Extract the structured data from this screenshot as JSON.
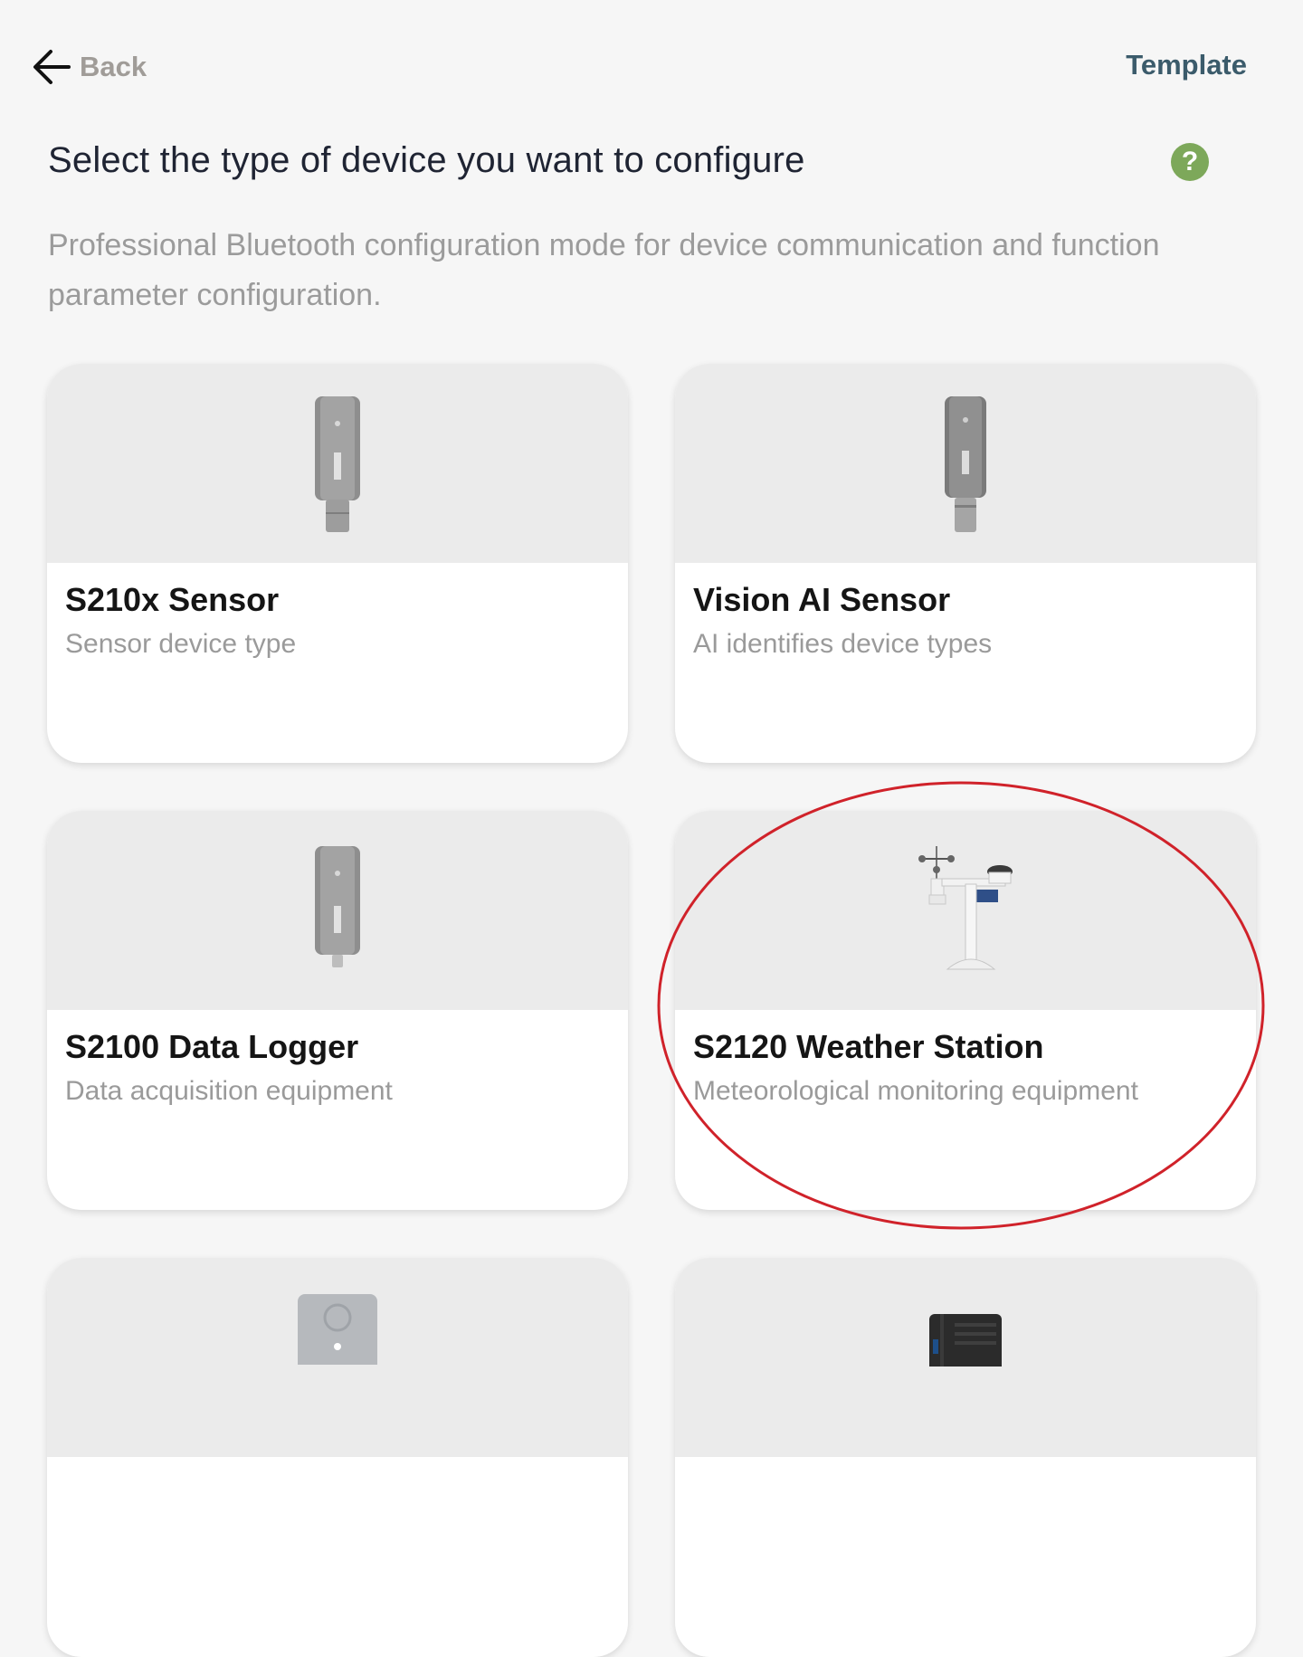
{
  "header": {
    "back_label": "Back",
    "template_label": "Template"
  },
  "page": {
    "title": "Select the type of device you want to configure",
    "help_symbol": "?",
    "subtitle": "Professional Bluetooth configuration mode for device communication and function parameter configuration."
  },
  "devices": [
    {
      "name": "S210x Sensor",
      "description": "Sensor device type",
      "icon": "sensor-device-icon"
    },
    {
      "name": "Vision AI Sensor",
      "description": "AI identifies device types",
      "icon": "vision-sensor-icon"
    },
    {
      "name": "S2100 Data Logger",
      "description": "Data acquisition equipment",
      "icon": "data-logger-icon"
    },
    {
      "name": "S2120 Weather Station",
      "description": "Meteorological monitoring equipment",
      "icon": "weather-station-icon"
    },
    {
      "name": "",
      "description": "",
      "icon": "button-device-icon"
    },
    {
      "name": "",
      "description": "",
      "icon": "gateway-device-icon"
    }
  ],
  "colors": {
    "accent": "#3b5b6b",
    "help": "#7da85a",
    "highlight": "#d0222a"
  }
}
